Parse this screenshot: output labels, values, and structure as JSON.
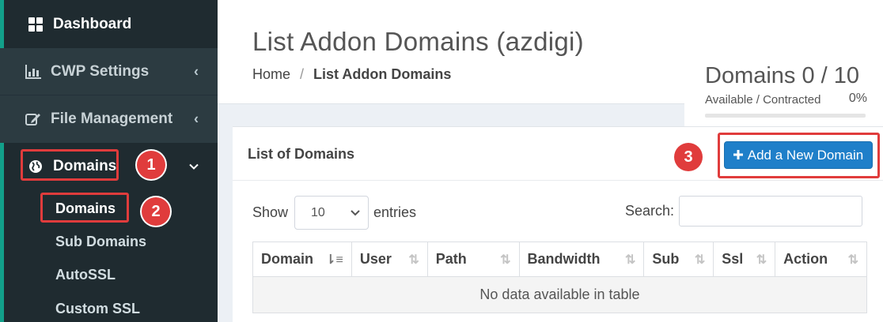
{
  "sidebar": {
    "items": [
      {
        "label": "Dashboard",
        "icon": "grid-icon"
      },
      {
        "label": "CWP Settings",
        "icon": "bar-chart-icon"
      },
      {
        "label": "File Management",
        "icon": "edit-icon"
      },
      {
        "label": "Domains",
        "icon": "globe-icon"
      }
    ],
    "submenu": [
      "Domains",
      "Sub Domains",
      "AutoSSL",
      "Custom SSL"
    ]
  },
  "header": {
    "title": "List Addon Domains (azdigi)",
    "breadcrumb": [
      "Home",
      "List Addon Domains"
    ]
  },
  "stats": {
    "title": "Domains 0 / 10",
    "subtitle": "Available / Contracted",
    "percent": "0%",
    "progress": 0
  },
  "box": {
    "title": "List of Domains",
    "add_button": "Add a New Domain",
    "show_label": "Show",
    "entries_value": "10",
    "entries_label": "entries",
    "search_label": "Search:",
    "columns": [
      "Domain",
      "User",
      "Path",
      "Bandwidth",
      "Sub",
      "Ssl",
      "Action"
    ],
    "empty_message": "No data available in table"
  },
  "annotations": [
    "1",
    "2",
    "3"
  ],
  "colors": {
    "sidebar_bg": "#2c3b41",
    "sidebar_active": "#1f2b30",
    "accent": "#12a08a",
    "button": "#1f7fc9",
    "highlight": "#e03c3c"
  }
}
